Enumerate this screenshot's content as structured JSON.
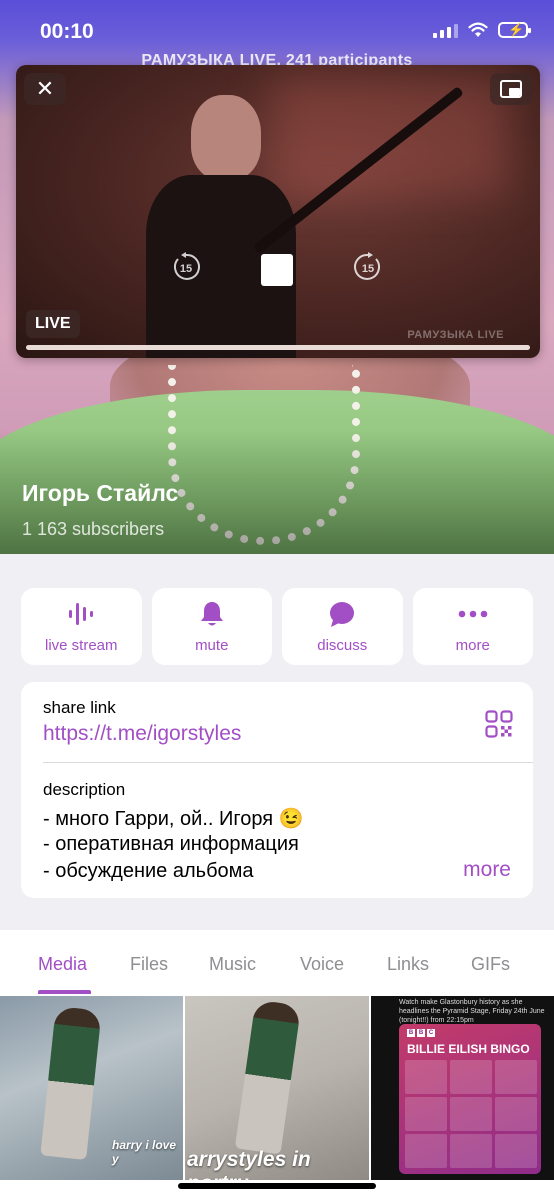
{
  "status_bar": {
    "time": "00:10"
  },
  "call_bar": {
    "text": "РАМУЗЫКА LIVE, 241 participants"
  },
  "player": {
    "live_label": "LIVE",
    "watermark": "РАМУЗЫКА LIVE",
    "skip_back_label": "15",
    "skip_forward_label": "15",
    "progress": 1.0,
    "icons": [
      "close-icon",
      "pip-expand-icon",
      "rewind-15-icon",
      "stop-icon",
      "forward-15-icon"
    ]
  },
  "profile": {
    "name": "Игорь Стайлс",
    "subscribers": "1 163 subscribers"
  },
  "actions": [
    {
      "label": "live stream",
      "icon": "live-stream-icon"
    },
    {
      "label": "mute",
      "icon": "bell-icon"
    },
    {
      "label": "discuss",
      "icon": "chat-bubble-icon"
    },
    {
      "label": "more",
      "icon": "more-dots-icon"
    }
  ],
  "info": {
    "share_link_label": "share link",
    "share_link": "https://t.me/igorstyles",
    "description_label": "description",
    "description_lines": [
      "- много Гарри, ой.. Игоря 😉",
      "- оперативная информация",
      "- обсуждение альбома"
    ],
    "more_label": "more"
  },
  "tabs": [
    "Media",
    "Files",
    "Music",
    "Voice",
    "Links",
    "GIFs"
  ],
  "active_tab": "Media",
  "media": {
    "tile1_caption": "harry i love y",
    "tile2_caption": "arrystyles in portru",
    "tile3_title": "BILLIE EILISH BINGO",
    "tile3_header": "Watch make Glastonbury history as she headlines the Pyramid Stage, Friday 24th June (tonight!!) from 22:15pm"
  },
  "colors": {
    "accent": "#a24fc6",
    "background": "#efeff4"
  }
}
